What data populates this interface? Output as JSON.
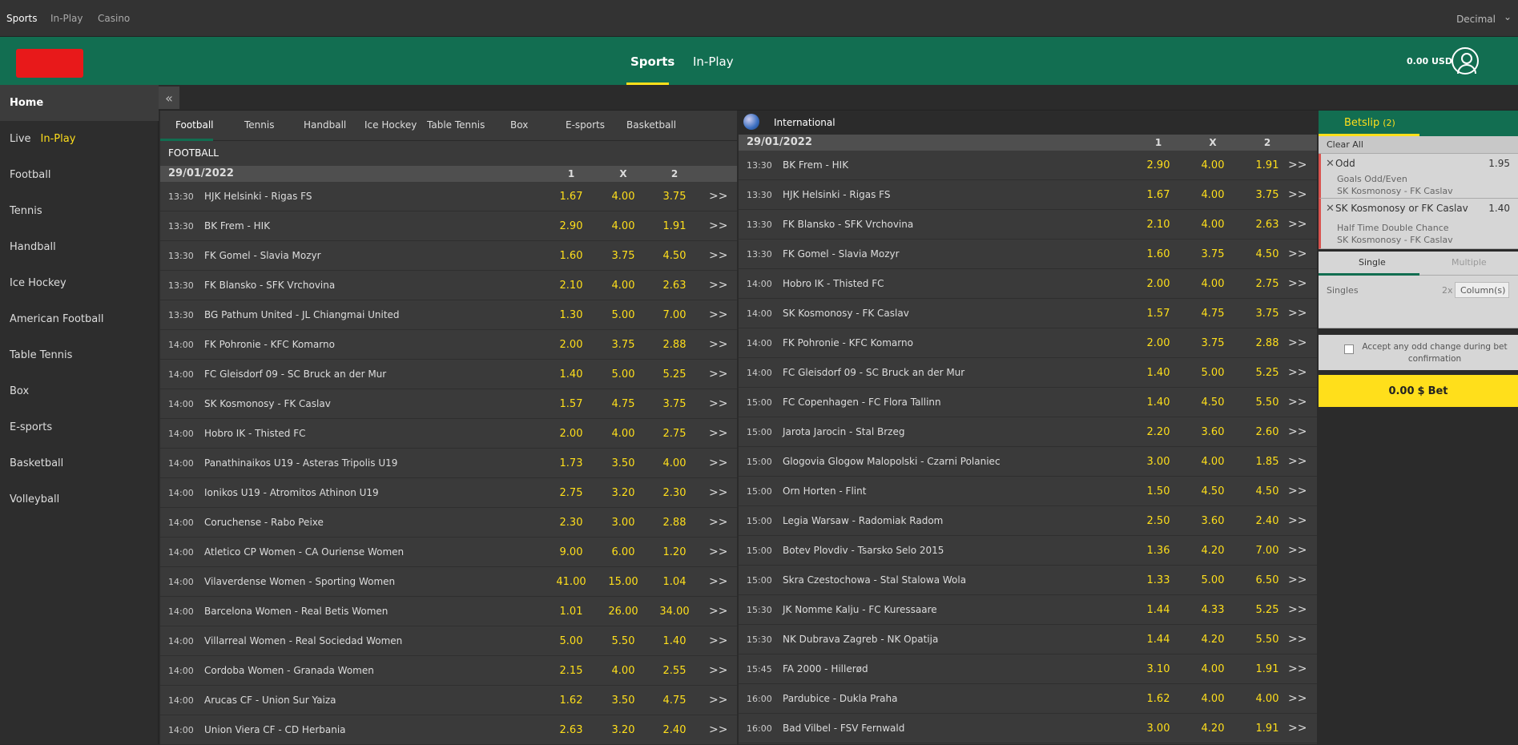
{
  "topbar": {
    "links": [
      "Sports",
      "In-Play",
      "Casino"
    ],
    "odds_format": "Decimal"
  },
  "header": {
    "nav": [
      "Sports",
      "In-Play"
    ],
    "balance": "0.00 USD"
  },
  "sidebar": {
    "items": [
      {
        "label": "Home"
      },
      {
        "label": "Live",
        "extra": "In-Play"
      },
      {
        "label": "Football"
      },
      {
        "label": "Tennis"
      },
      {
        "label": "Handball"
      },
      {
        "label": "Ice Hockey"
      },
      {
        "label": "American Football"
      },
      {
        "label": "Table Tennis"
      },
      {
        "label": "Box"
      },
      {
        "label": "E-sports"
      },
      {
        "label": "Basketball"
      },
      {
        "label": "Volleyball"
      }
    ]
  },
  "collapse_icon": "«",
  "left": {
    "tabs": [
      "Football",
      "Tennis",
      "Handball",
      "Ice Hockey",
      "Table Tennis",
      "Box",
      "E-sports",
      "Basketball"
    ],
    "section": "FOOTBALL",
    "date": "29/01/2022",
    "headers": [
      "1",
      "X",
      "2"
    ],
    "more": ">>",
    "matches": [
      {
        "time": "13:30",
        "name": "HJK Helsinki - Rigas FS",
        "o1": "1.67",
        "ox": "4.00",
        "o2": "3.75"
      },
      {
        "time": "13:30",
        "name": "BK Frem - HIK",
        "o1": "2.90",
        "ox": "4.00",
        "o2": "1.91"
      },
      {
        "time": "13:30",
        "name": "FK Gomel - Slavia Mozyr",
        "o1": "1.60",
        "ox": "3.75",
        "o2": "4.50"
      },
      {
        "time": "13:30",
        "name": "FK Blansko - SFK Vrchovina",
        "o1": "2.10",
        "ox": "4.00",
        "o2": "2.63"
      },
      {
        "time": "13:30",
        "name": "BG Pathum United - JL Chiangmai United",
        "o1": "1.30",
        "ox": "5.00",
        "o2": "7.00"
      },
      {
        "time": "14:00",
        "name": "FK Pohronie - KFC Komarno",
        "o1": "2.00",
        "ox": "3.75",
        "o2": "2.88"
      },
      {
        "time": "14:00",
        "name": "FC Gleisdorf 09 - SC Bruck an der Mur",
        "o1": "1.40",
        "ox": "5.00",
        "o2": "5.25"
      },
      {
        "time": "14:00",
        "name": "SK Kosmonosy - FK Caslav",
        "o1": "1.57",
        "ox": "4.75",
        "o2": "3.75"
      },
      {
        "time": "14:00",
        "name": "Hobro IK - Thisted FC",
        "o1": "2.00",
        "ox": "4.00",
        "o2": "2.75"
      },
      {
        "time": "14:00",
        "name": "Panathinaikos U19 - Asteras Tripolis U19",
        "o1": "1.73",
        "ox": "3.50",
        "o2": "4.00"
      },
      {
        "time": "14:00",
        "name": "Ionikos U19 - Atromitos Athinon U19",
        "o1": "2.75",
        "ox": "3.20",
        "o2": "2.30"
      },
      {
        "time": "14:00",
        "name": "Coruchense - Rabo Peixe",
        "o1": "2.30",
        "ox": "3.00",
        "o2": "2.88"
      },
      {
        "time": "14:00",
        "name": "Atletico CP Women - CA Ouriense Women",
        "o1": "9.00",
        "ox": "6.00",
        "o2": "1.20"
      },
      {
        "time": "14:00",
        "name": "Vilaverdense Women - Sporting Women",
        "o1": "41.00",
        "ox": "15.00",
        "o2": "1.04"
      },
      {
        "time": "14:00",
        "name": "Barcelona Women - Real Betis Women",
        "o1": "1.01",
        "ox": "26.00",
        "o2": "34.00"
      },
      {
        "time": "14:00",
        "name": "Villarreal Women - Real Sociedad Women",
        "o1": "5.00",
        "ox": "5.50",
        "o2": "1.40"
      },
      {
        "time": "14:00",
        "name": "Cordoba Women - Granada Women",
        "o1": "2.15",
        "ox": "4.00",
        "o2": "2.55"
      },
      {
        "time": "14:00",
        "name": "Arucas CF - Union Sur Yaiza",
        "o1": "1.62",
        "ox": "3.50",
        "o2": "4.75"
      },
      {
        "time": "14:00",
        "name": "Union Viera CF - CD Herbania",
        "o1": "2.63",
        "ox": "3.20",
        "o2": "2.40"
      }
    ]
  },
  "right": {
    "region": "International",
    "date": "29/01/2022",
    "headers": [
      "1",
      "X",
      "2"
    ],
    "more": ">>",
    "matches": [
      {
        "time": "13:30",
        "name": "BK Frem - HIK",
        "o1": "2.90",
        "ox": "4.00",
        "o2": "1.91"
      },
      {
        "time": "13:30",
        "name": "HJK Helsinki - Rigas FS",
        "o1": "1.67",
        "ox": "4.00",
        "o2": "3.75"
      },
      {
        "time": "13:30",
        "name": "FK Blansko - SFK Vrchovina",
        "o1": "2.10",
        "ox": "4.00",
        "o2": "2.63"
      },
      {
        "time": "13:30",
        "name": "FK Gomel - Slavia Mozyr",
        "o1": "1.60",
        "ox": "3.75",
        "o2": "4.50"
      },
      {
        "time": "14:00",
        "name": "Hobro IK - Thisted FC",
        "o1": "2.00",
        "ox": "4.00",
        "o2": "2.75"
      },
      {
        "time": "14:00",
        "name": "SK Kosmonosy - FK Caslav",
        "o1": "1.57",
        "ox": "4.75",
        "o2": "3.75"
      },
      {
        "time": "14:00",
        "name": "FK Pohronie - KFC Komarno",
        "o1": "2.00",
        "ox": "3.75",
        "o2": "2.88"
      },
      {
        "time": "14:00",
        "name": "FC Gleisdorf 09 - SC Bruck an der Mur",
        "o1": "1.40",
        "ox": "5.00",
        "o2": "5.25"
      },
      {
        "time": "15:00",
        "name": "FC Copenhagen - FC Flora Tallinn",
        "o1": "1.40",
        "ox": "4.50",
        "o2": "5.50"
      },
      {
        "time": "15:00",
        "name": "Jarota Jarocin - Stal Brzeg",
        "o1": "2.20",
        "ox": "3.60",
        "o2": "2.60"
      },
      {
        "time": "15:00",
        "name": "Glogovia Glogow Malopolski - Czarni Polaniec",
        "o1": "3.00",
        "ox": "4.00",
        "o2": "1.85"
      },
      {
        "time": "15:00",
        "name": "Orn Horten - Flint",
        "o1": "1.50",
        "ox": "4.50",
        "o2": "4.50"
      },
      {
        "time": "15:00",
        "name": "Legia Warsaw - Radomiak Radom",
        "o1": "2.50",
        "ox": "3.60",
        "o2": "2.40"
      },
      {
        "time": "15:00",
        "name": "Botev Plovdiv - Tsarsko Selo 2015",
        "o1": "1.36",
        "ox": "4.20",
        "o2": "7.00"
      },
      {
        "time": "15:00",
        "name": "Skra Czestochowa - Stal Stalowa Wola",
        "o1": "1.33",
        "ox": "5.00",
        "o2": "6.50"
      },
      {
        "time": "15:30",
        "name": "JK Nomme Kalju - FC Kuressaare",
        "o1": "1.44",
        "ox": "4.33",
        "o2": "5.25"
      },
      {
        "time": "15:30",
        "name": "NK Dubrava Zagreb - NK Opatija",
        "o1": "1.44",
        "ox": "4.20",
        "o2": "5.50"
      },
      {
        "time": "15:45",
        "name": "FA 2000 - Hillerød",
        "o1": "3.10",
        "ox": "4.00",
        "o2": "1.91"
      },
      {
        "time": "16:00",
        "name": "Pardubice - Dukla Praha",
        "o1": "1.62",
        "ox": "4.00",
        "o2": "4.00"
      },
      {
        "time": "16:00",
        "name": "Bad Vilbel - FSV Fernwald",
        "o1": "3.00",
        "ox": "4.20",
        "o2": "1.91"
      }
    ]
  },
  "betslip": {
    "title": "Betslip",
    "count": "(2)",
    "clear": "Clear All",
    "bets": [
      {
        "selection": "Odd",
        "price": "1.95",
        "market": "Goals Odd/Even",
        "event": "SK Kosmonosy - FK Caslav"
      },
      {
        "selection": "SK Kosmonosy or FK Caslav",
        "price": "1.40",
        "market": "Half Time Double Chance",
        "event": "SK Kosmonosy - FK Caslav"
      }
    ],
    "modes": [
      "Single",
      "Multiple"
    ],
    "singles_label": "Singles",
    "multiplier": "2x",
    "column_placeholder": "Column(s)",
    "accept_text": "Accept any odd change during bet confirmation",
    "place_amount": "0.00",
    "place_currency": "$",
    "place_label": "Bet"
  },
  "colors": {
    "brand_green": "#126e51",
    "odds_yellow": "#ffdf1b",
    "logo_red": "#e8191a"
  }
}
